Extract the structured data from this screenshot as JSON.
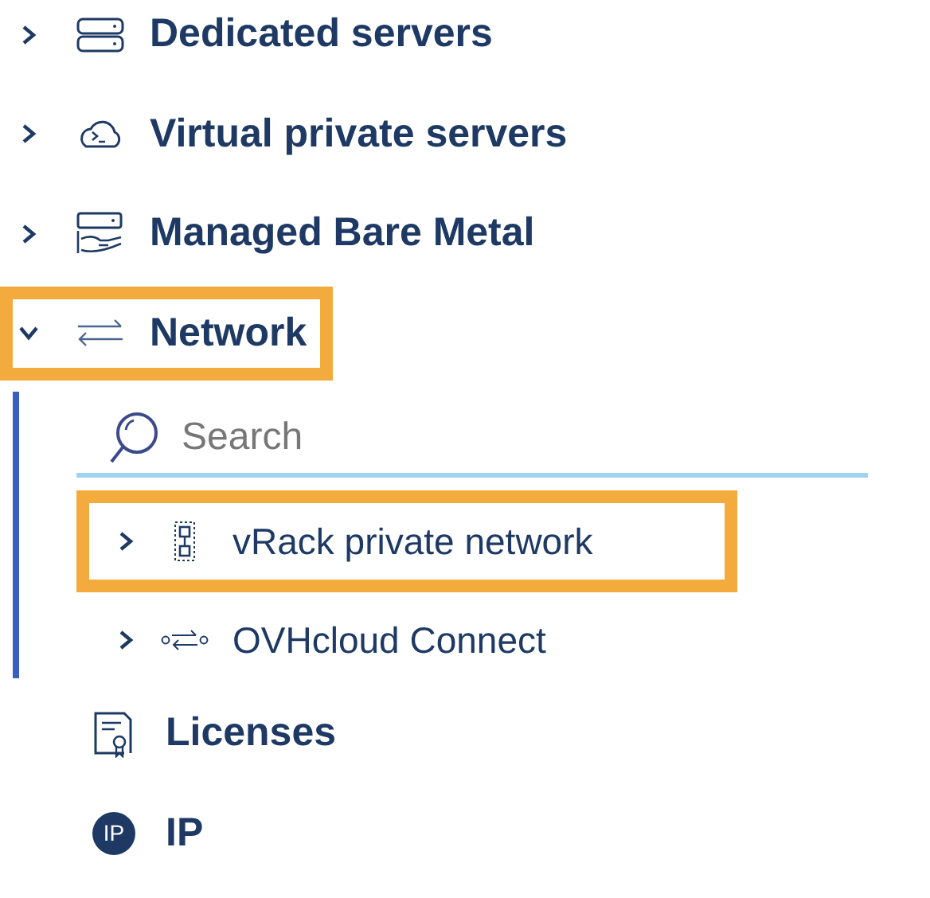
{
  "menu": [
    {
      "label": "Dedicated servers",
      "kind": "group",
      "expanded": false,
      "highlighted": false
    },
    {
      "label": "Virtual private servers",
      "kind": "group",
      "expanded": false,
      "highlighted": false
    },
    {
      "label": "Managed Bare Metal",
      "kind": "group",
      "expanded": false,
      "highlighted": false
    },
    {
      "label": "Network",
      "kind": "group",
      "expanded": true,
      "highlighted": true,
      "search": {
        "placeholder": "Search"
      },
      "children": [
        {
          "label": "vRack private network",
          "expanded": false,
          "highlighted": true
        },
        {
          "label": "OVHcloud Connect",
          "expanded": false,
          "highlighted": false
        }
      ]
    },
    {
      "label": "Licenses",
      "kind": "link",
      "highlighted": false
    },
    {
      "label": "IP",
      "kind": "link",
      "highlighted": false,
      "badge": "IP"
    }
  ]
}
